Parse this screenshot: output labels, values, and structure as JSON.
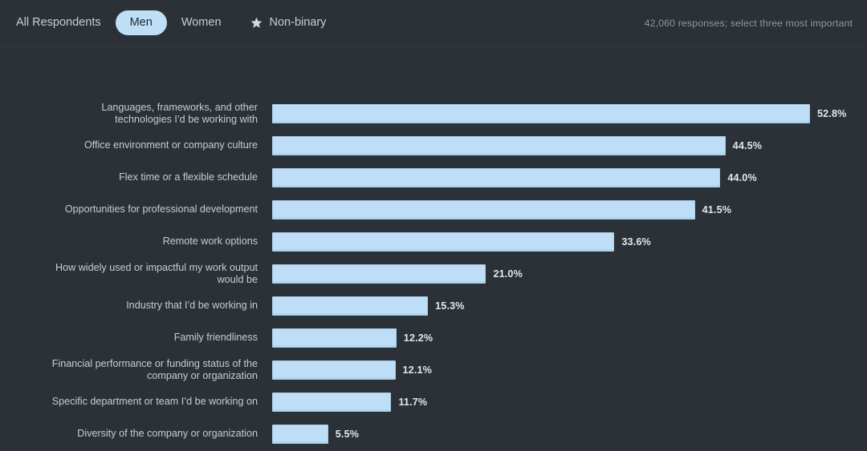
{
  "header": {
    "tabs": [
      {
        "label": "All Respondents",
        "active": false,
        "icon": null
      },
      {
        "label": "Men",
        "active": true,
        "icon": null
      },
      {
        "label": "Women",
        "active": false,
        "icon": null
      },
      {
        "label": "Non-binary",
        "active": false,
        "icon": "star-icon"
      }
    ],
    "response_note": "42,060 responses; select three most important"
  },
  "colors": {
    "background": "#2b3136",
    "bar_fill": "#bedef8",
    "bar_stroke": "#a9cfe9",
    "active_pill": "#bedff6",
    "label_text": "#c8cdd2",
    "value_text": "#e3e7ea",
    "muted_text": "#8d969e",
    "divider": "#343a40"
  },
  "chart_data": {
    "type": "bar",
    "orientation": "horizontal",
    "title": "",
    "subtitle": "",
    "xlabel": "",
    "ylabel": "",
    "xlim": [
      0,
      52.8
    ],
    "grid": false,
    "legend": null,
    "value_suffix": "%",
    "categories": [
      "Languages, frameworks, and other\ntechnologies I’d be working with",
      "Office environment or company culture",
      "Flex time or a flexible schedule",
      "Opportunities for professional development",
      "Remote work options",
      "How widely used or impactful my work output\nwould be",
      "Industry that I’d be working in",
      "Family friendliness",
      "Financial performance or funding status of the\ncompany or organization",
      "Specific department or team I’d be working on",
      "Diversity of the company or organization"
    ],
    "values": [
      52.8,
      44.5,
      44.0,
      41.5,
      33.6,
      21.0,
      15.3,
      12.2,
      12.1,
      11.7,
      5.5
    ],
    "value_labels": [
      "52.8%",
      "44.5%",
      "44.0%",
      "41.5%",
      "33.6%",
      "21.0%",
      "15.3%",
      "12.2%",
      "12.1%",
      "11.7%",
      "5.5%"
    ]
  }
}
